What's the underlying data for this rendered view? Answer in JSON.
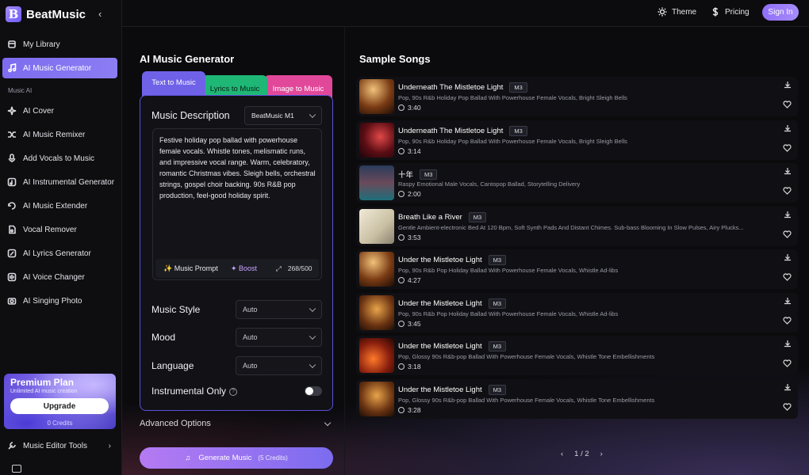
{
  "brand": {
    "name": "BeatMusic",
    "logo_letter": "B"
  },
  "sidebar": {
    "items": [
      {
        "label": "My Library",
        "icon": "library-icon"
      },
      {
        "label": "AI Music Generator",
        "icon": "music-note-icon"
      },
      {
        "label": "AI Cover",
        "icon": "sparkle-icon"
      },
      {
        "label": "AI Music Remixer",
        "icon": "shuffle-icon"
      },
      {
        "label": "Add Vocals to Music",
        "icon": "mic-icon"
      },
      {
        "label": "AI Instrumental Generator",
        "icon": "instrument-icon"
      },
      {
        "label": "AI Music Extender",
        "icon": "extend-icon"
      },
      {
        "label": "Vocal Remover",
        "icon": "vocal-remove-icon"
      },
      {
        "label": "AI Lyrics Generator",
        "icon": "pen-icon"
      },
      {
        "label": "AI Voice Changer",
        "icon": "voice-icon"
      },
      {
        "label": "AI Singing Photo",
        "icon": "camera-icon"
      }
    ],
    "section_label": "Music AI",
    "premium": {
      "title": "Premium Plan",
      "subtitle": "Unlimited AI music creation",
      "button": "Upgrade",
      "credits": "0 Credits"
    },
    "editor_tools": "Music Editor Tools"
  },
  "header": {
    "theme": "Theme",
    "pricing": "Pricing",
    "signin": "Sign In"
  },
  "generator": {
    "title": "AI Music Generator",
    "tabs": [
      "Text to Music",
      "Lyrics to Music",
      "Image to Music"
    ],
    "description_label": "Music Description",
    "model": "BeatMusic M1",
    "description": "Festive holiday pop ballad with powerhouse female vocals. Whistle tones, melismatic runs, and impressive vocal range. Warm, celebratory, romantic Christmas vibes. Sleigh bells, orchestral strings, gospel choir backing. 90s R&B pop production, feel-good holiday spirit.",
    "prompt_button": "Music Prompt",
    "boost_button": "Boost",
    "counter": "268/500",
    "style_label": "Music Style",
    "style_value": "Auto",
    "mood_label": "Mood",
    "mood_value": "Auto",
    "language_label": "Language",
    "language_value": "Auto",
    "instrumental_label": "Instrumental Only",
    "instrumental_on": false,
    "advanced": "Advanced Options",
    "generate": "Generate Music",
    "generate_credits": "(5 Credits)"
  },
  "songs": {
    "title": "Sample Songs",
    "items": [
      {
        "name": "Underneath The Mistletoe Light",
        "tag": "M3",
        "desc": "Pop, 90s R&b Holiday Pop Ballad With Powerhouse Female Vocals, Bright Sleigh Bells",
        "dur": "3:40",
        "thumb": "warm"
      },
      {
        "name": "Underneath The Mistletoe Light",
        "tag": "M3",
        "desc": "Pop, 90s R&b Holiday Pop Ballad With Powerhouse Female Vocals, Bright Sleigh Bells",
        "dur": "3:14",
        "thumb": "red"
      },
      {
        "name": "十年",
        "tag": "M3",
        "desc": "Raspy Emotional Male Vocals, Cantopop Ballad, Storytelling Delivery",
        "dur": "2:00",
        "thumb": "city"
      },
      {
        "name": "Breath Like a River",
        "tag": "M3",
        "desc": "Gentle Ambient-electronic Bed At 120 Bpm, Soft Synth Pads And Distant Chimes. Sub-bass Blooming In Slow Pulses, Airy Plucks...",
        "dur": "3:53",
        "thumb": "light"
      },
      {
        "name": "Under the Mistletoe Light",
        "tag": "M3",
        "desc": "Pop, 90s R&b Pop Holiday Ballad With Powerhouse Female Vocals, Whistle Ad-libs",
        "dur": "4:27",
        "thumb": "warm"
      },
      {
        "name": "Under the Mistletoe Light",
        "tag": "M3",
        "desc": "Pop, 90s R&b Pop Holiday Ballad With Powerhouse Female Vocals, Whistle Ad-libs",
        "dur": "3:45",
        "thumb": "amber"
      },
      {
        "name": "Under the Mistletoe Light",
        "tag": "M3",
        "desc": "Pop, Glossy 90s R&b-pop Ballad With Powerhouse Female Vocals, Whistle Tone Embellishments",
        "dur": "3:18",
        "thumb": "fire"
      },
      {
        "name": "Under the Mistletoe Light",
        "tag": "M3",
        "desc": "Pop, Glossy 90s R&b-pop Ballad With Powerhouse Female Vocals, Whistle Tone Embellishments",
        "dur": "3:28",
        "thumb": "amber"
      }
    ],
    "pager": "1 / 2"
  },
  "colors": {
    "accent": "#7d6cf0",
    "lyrics_tab": "#1fb776",
    "image_tab": "#e2489a"
  }
}
